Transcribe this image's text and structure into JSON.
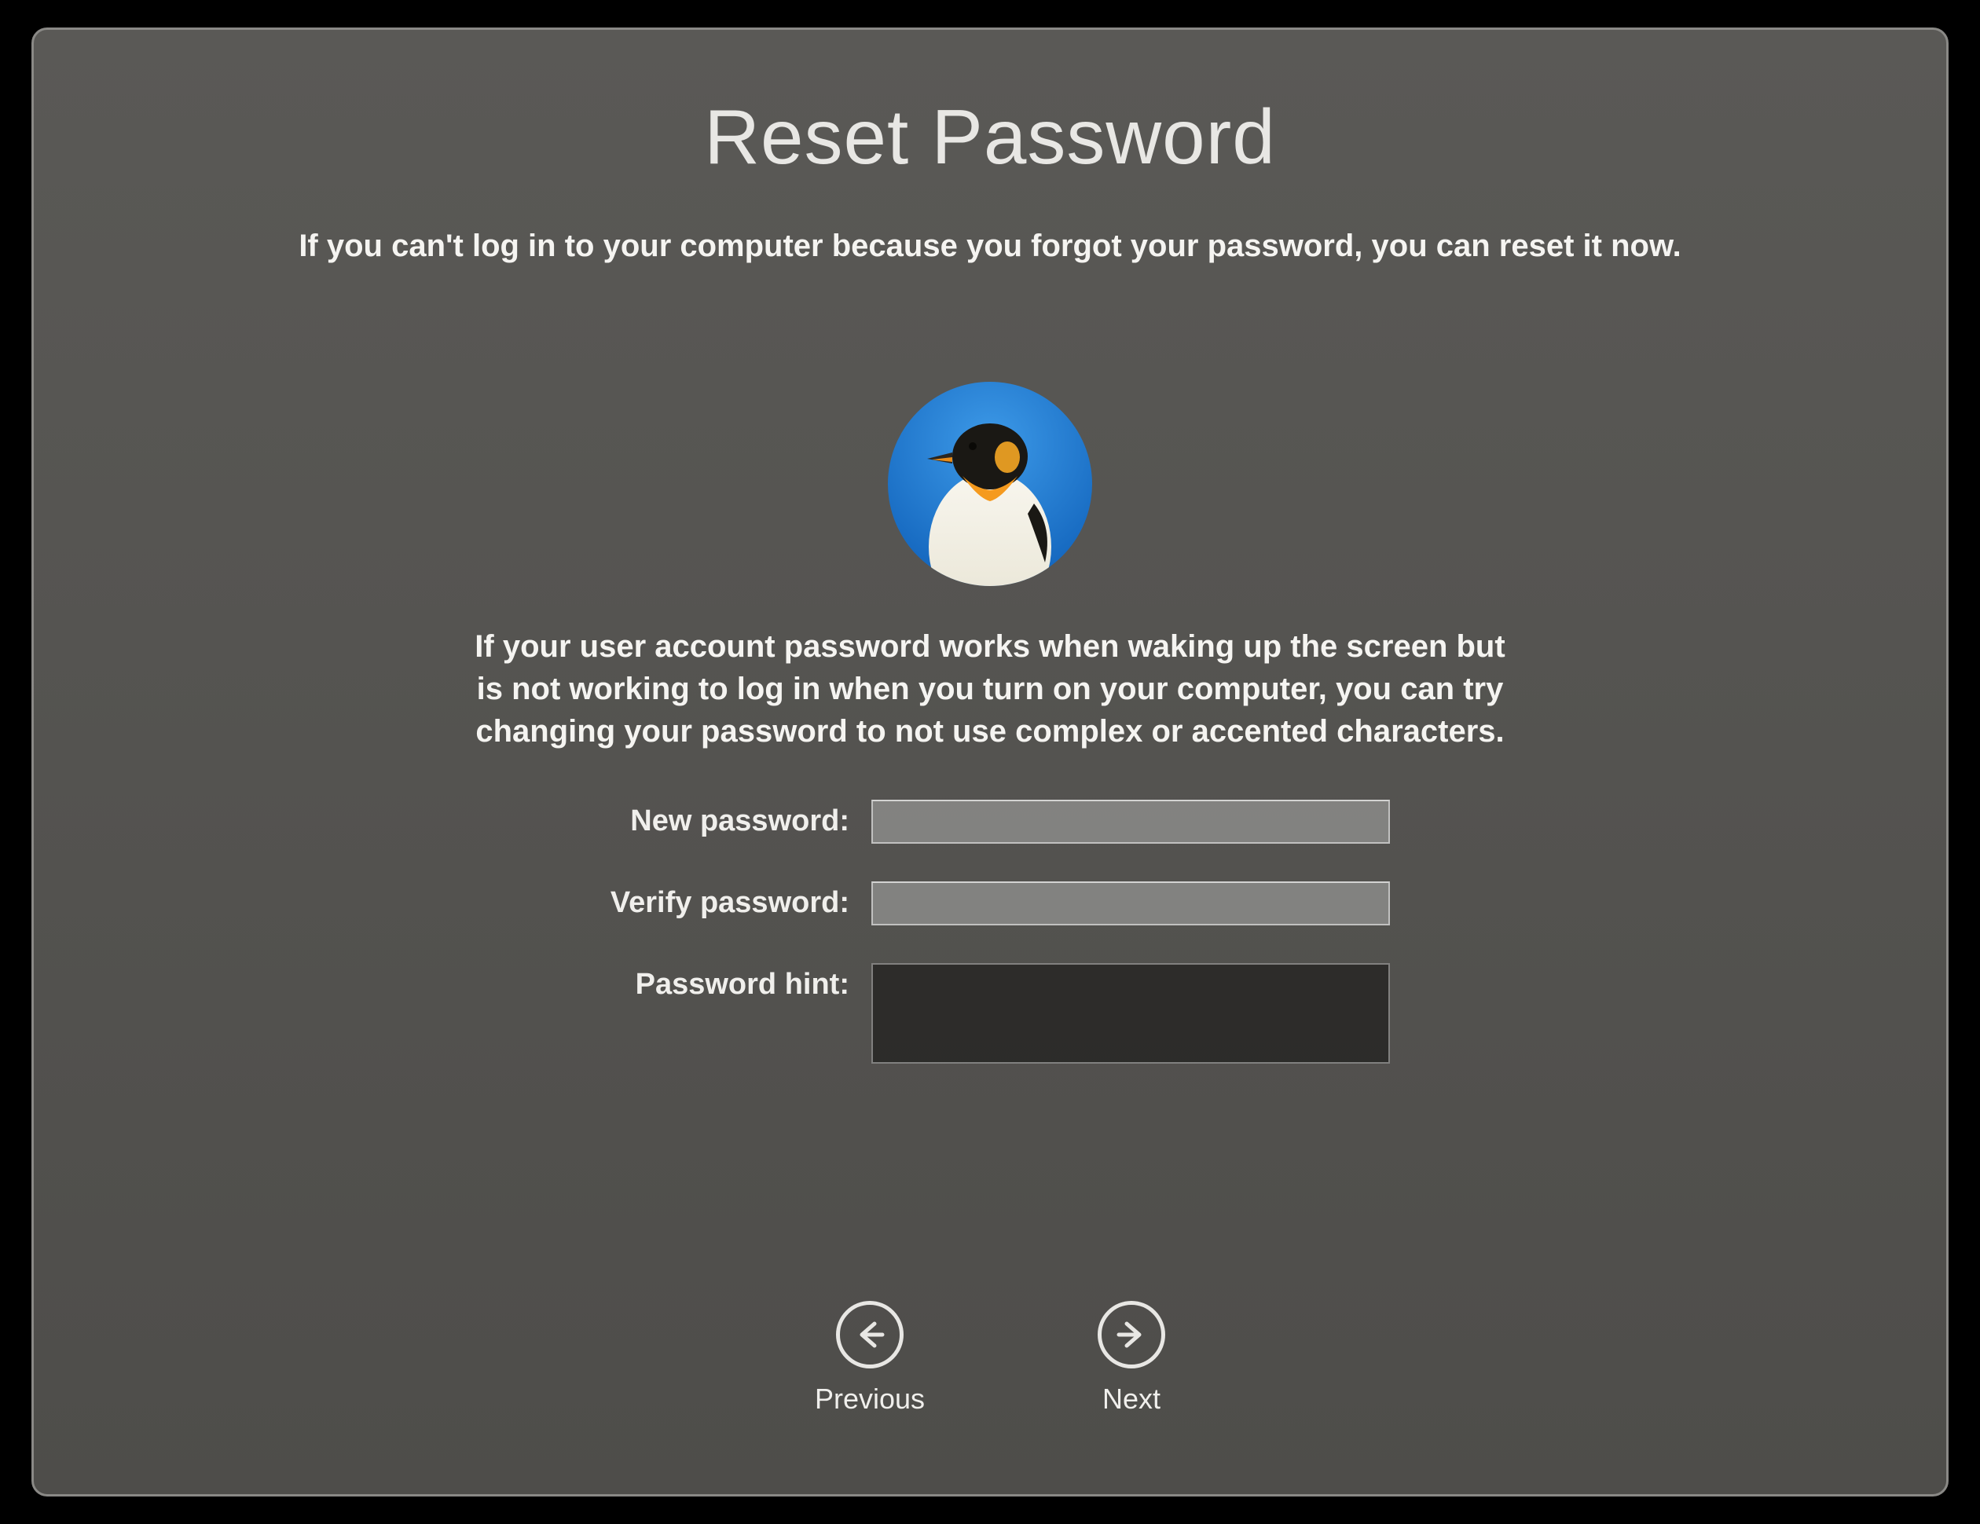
{
  "title": "Reset Password",
  "subtitle": "If you can't log in to your computer because you forgot your password, you can reset it now.",
  "avatar": {
    "semantic": "penguin-avatar"
  },
  "description": "If your user account password works when waking up the screen but is not working to log in when you turn on your computer, you can try changing your password to not use complex or accented characters.",
  "form": {
    "newPassword": {
      "label": "New password:",
      "value": ""
    },
    "verifyPassword": {
      "label": "Verify password:",
      "value": ""
    },
    "passwordHint": {
      "label": "Password hint:",
      "value": ""
    }
  },
  "nav": {
    "previous": "Previous",
    "next": "Next"
  }
}
